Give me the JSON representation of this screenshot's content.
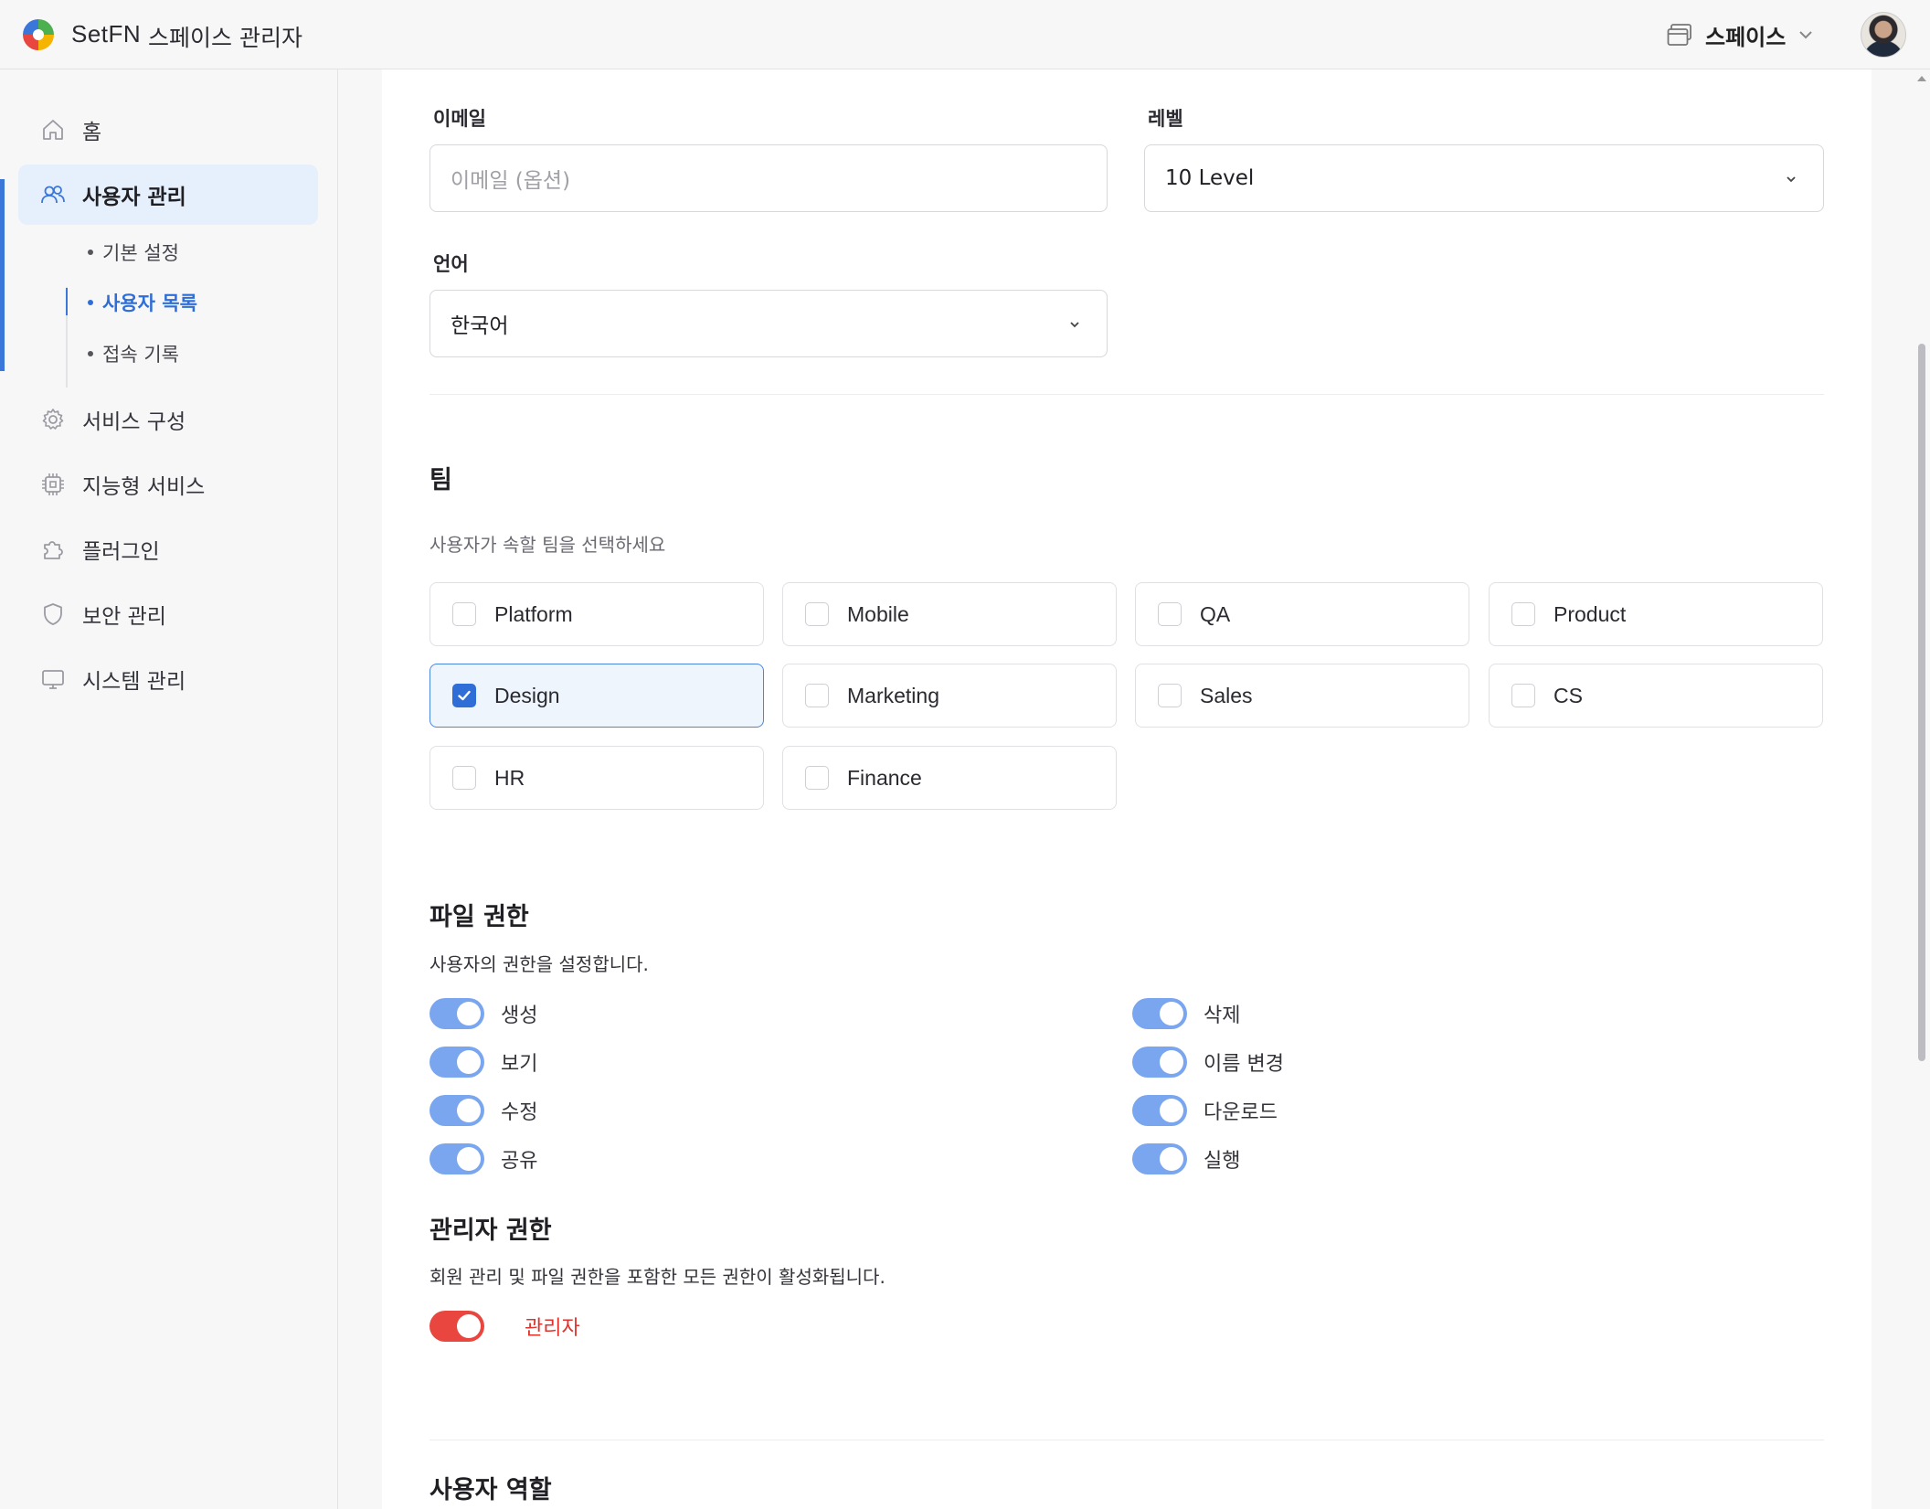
{
  "header": {
    "brand": "SetFN",
    "subtitle": "스페이스 관리자",
    "space_label": "스페이스"
  },
  "sidebar": {
    "items": [
      {
        "label": "홈",
        "icon": "home-icon"
      },
      {
        "label": "사용자 관리",
        "icon": "users-icon",
        "active": true
      },
      {
        "label": "서비스 구성",
        "icon": "gear-icon"
      },
      {
        "label": "지능형 서비스",
        "icon": "chip-icon"
      },
      {
        "label": "플러그인",
        "icon": "puzzle-icon"
      },
      {
        "label": "보안 관리",
        "icon": "shield-icon"
      },
      {
        "label": "시스템 관리",
        "icon": "monitor-icon"
      }
    ],
    "sub_items": [
      {
        "label": "기본 설정"
      },
      {
        "label": "사용자 목록",
        "active": true
      },
      {
        "label": "접속 기록"
      }
    ]
  },
  "form": {
    "email": {
      "label": "이메일",
      "placeholder": "이메일 (옵션)"
    },
    "level": {
      "label": "레벨",
      "value": "10 Level"
    },
    "language": {
      "label": "언어",
      "value": "한국어"
    }
  },
  "teams": {
    "title": "팀",
    "description": "사용자가 속할 팀을 선택하세요",
    "items": [
      {
        "name": "Platform",
        "checked": false
      },
      {
        "name": "Mobile",
        "checked": false
      },
      {
        "name": "QA",
        "checked": false
      },
      {
        "name": "Product",
        "checked": false
      },
      {
        "name": "Design",
        "checked": true
      },
      {
        "name": "Marketing",
        "checked": false
      },
      {
        "name": "Sales",
        "checked": false
      },
      {
        "name": "CS",
        "checked": false
      },
      {
        "name": "HR",
        "checked": false
      },
      {
        "name": "Finance",
        "checked": false
      }
    ]
  },
  "file_permissions": {
    "title": "파일 권한",
    "description": "사용자의 권한을 설정합니다.",
    "items": [
      {
        "label": "생성",
        "on": true
      },
      {
        "label": "삭제",
        "on": true
      },
      {
        "label": "보기",
        "on": true
      },
      {
        "label": "이름 변경",
        "on": true
      },
      {
        "label": "수정",
        "on": true
      },
      {
        "label": "다운로드",
        "on": true
      },
      {
        "label": "공유",
        "on": true
      },
      {
        "label": "실행",
        "on": true
      }
    ]
  },
  "admin_permissions": {
    "title": "관리자 권한",
    "description": "회원 관리 및 파일 권한을 포함한 모든 권한이 활성화됩니다.",
    "toggle_label": "관리자",
    "on": true
  },
  "user_role": {
    "title": "사용자 역할"
  },
  "colors": {
    "accent": "#2f6ed6",
    "toggle_on": "#7aa6ef",
    "admin_toggle": "#e8463f"
  }
}
